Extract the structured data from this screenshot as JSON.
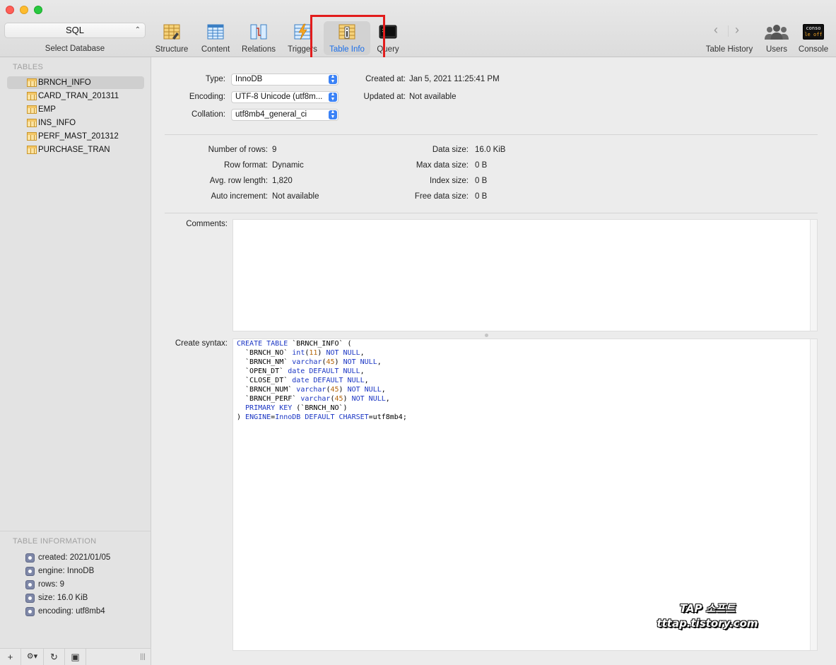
{
  "toolbar": {
    "database_select": {
      "value": "SQL",
      "label": "Select Database"
    },
    "tabs": [
      {
        "label": "Structure",
        "icon": "structure-icon"
      },
      {
        "label": "Content",
        "icon": "content-icon"
      },
      {
        "label": "Relations",
        "icon": "relations-icon"
      },
      {
        "label": "Triggers",
        "icon": "triggers-icon"
      },
      {
        "label": "Table Info",
        "icon": "table-info-icon",
        "active": true
      },
      {
        "label": "Query",
        "icon": "query-icon"
      }
    ],
    "right": {
      "history_label": "Table History",
      "users_label": "Users",
      "console_label": "Console",
      "console_icon_text_1": "conso",
      "console_icon_text_2": "le off"
    }
  },
  "sidebar": {
    "tables_title": "TABLES",
    "tables": [
      "BRNCH_INFO",
      "CARD_TRAN_201311",
      "EMP",
      "INS_INFO",
      "PERF_MAST_201312",
      "PURCHASE_TRAN"
    ],
    "selected_table": "BRNCH_INFO",
    "info_title": "TABLE INFORMATION",
    "info_items": [
      "created: 2021/01/05",
      "engine: InnoDB",
      "rows: 9",
      "size: 16.0 KiB",
      "encoding: utf8mb4"
    ],
    "bottom_buttons": [
      "+",
      "⚙▾",
      "↻",
      "▣",
      "|||"
    ]
  },
  "info": {
    "type_label": "Type:",
    "type_value": "InnoDB",
    "encoding_label": "Encoding:",
    "encoding_value": "UTF-8 Unicode (utf8m...",
    "collation_label": "Collation:",
    "collation_value": "utf8mb4_general_ci",
    "created_label": "Created at:",
    "created_value": "Jan 5, 2021 11:25:41 PM",
    "updated_label": "Updated at:",
    "updated_value": "Not available",
    "rows_label": "Number of rows:",
    "rows_value": "9",
    "row_format_label": "Row format:",
    "row_format_value": "Dynamic",
    "avg_row_label": "Avg. row length:",
    "avg_row_value": "1,820",
    "auto_inc_label": "Auto increment:",
    "auto_inc_value": "Not available",
    "data_size_label": "Data size:",
    "data_size_value": "16.0 KiB",
    "max_data_label": "Max data size:",
    "max_data_value": "0 B",
    "index_size_label": "Index size:",
    "index_size_value": "0 B",
    "free_data_label": "Free data size:",
    "free_data_value": "0 B",
    "comments_label": "Comments:",
    "create_syntax_label": "Create syntax:"
  },
  "create_syntax": [
    [
      [
        "kw",
        "CREATE TABLE "
      ],
      [
        "t",
        "`BRNCH_INFO` ("
      ]
    ],
    [
      [
        "t",
        "  `BRNCH_NO` "
      ],
      [
        "kw",
        "int"
      ],
      [
        "t",
        "("
      ],
      [
        "num",
        "11"
      ],
      [
        "t",
        ") "
      ],
      [
        "kw",
        "NOT NULL"
      ],
      [
        "t",
        ","
      ]
    ],
    [
      [
        "t",
        "  `BRNCH_NM` "
      ],
      [
        "kw",
        "varchar"
      ],
      [
        "t",
        "("
      ],
      [
        "num",
        "45"
      ],
      [
        "t",
        ") "
      ],
      [
        "kw",
        "NOT NULL"
      ],
      [
        "t",
        ","
      ]
    ],
    [
      [
        "t",
        "  `OPEN_DT` "
      ],
      [
        "kw",
        "date DEFAULT NULL"
      ],
      [
        "t",
        ","
      ]
    ],
    [
      [
        "t",
        "  `CLOSE_DT` "
      ],
      [
        "kw",
        "date DEFAULT NULL"
      ],
      [
        "t",
        ","
      ]
    ],
    [
      [
        "t",
        "  `BRNCH_NUM` "
      ],
      [
        "kw",
        "varchar"
      ],
      [
        "t",
        "("
      ],
      [
        "num",
        "45"
      ],
      [
        "t",
        ") "
      ],
      [
        "kw",
        "NOT NULL"
      ],
      [
        "t",
        ","
      ]
    ],
    [
      [
        "t",
        "  `BRNCH_PERF` "
      ],
      [
        "kw",
        "varchar"
      ],
      [
        "t",
        "("
      ],
      [
        "num",
        "45"
      ],
      [
        "t",
        ") "
      ],
      [
        "kw",
        "NOT NULL"
      ],
      [
        "t",
        ","
      ]
    ],
    [
      [
        "kw",
        "  PRIMARY KEY "
      ],
      [
        "t",
        "(`BRNCH_NO`)"
      ]
    ],
    [
      [
        "t",
        ") "
      ],
      [
        "kw",
        "ENGINE"
      ],
      [
        "t",
        "="
      ],
      [
        "kw",
        "InnoDB DEFAULT CHARSET"
      ],
      [
        "t",
        "=utf8mb4;"
      ]
    ]
  ],
  "watermark": {
    "line1": "TAP 소프트",
    "line2": "tttap.tistory.com"
  },
  "colors": {
    "accent": "#1b6ee8",
    "highlight_box": "#e21c1c",
    "keyword": "#1b36c4",
    "number": "#b4660a"
  }
}
